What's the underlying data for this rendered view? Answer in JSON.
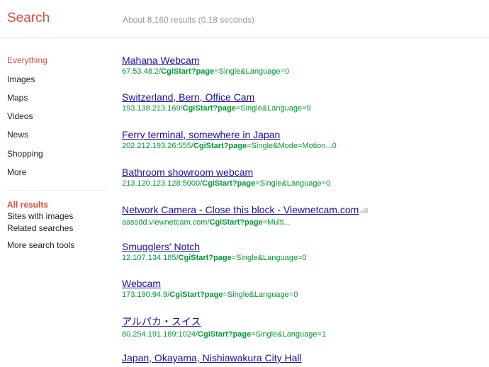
{
  "header": {
    "search_label": "Search",
    "result_stats": "About 8,160 results (0.18 seconds)"
  },
  "sidebar": {
    "categories": [
      "Everything",
      "Images",
      "Maps",
      "Videos",
      "News",
      "Shopping",
      "More"
    ],
    "active_category": "Everything",
    "filters": [
      "All results",
      "Sites with images",
      "Related searches"
    ],
    "active_filter": "All results",
    "more_tools": "More search tools"
  },
  "results": [
    {
      "title": "Mahana Webcam",
      "url_pre": "67.53.48.2/",
      "url_bold": "CgiStart?page",
      "url_post": "=Single&Language=0"
    },
    {
      "title": "Switzerland, Bern, Office Cam",
      "url_pre": "193.138.213.169/",
      "url_bold": "CgiStart?page",
      "url_post": "=Single&Language=9"
    },
    {
      "title": "Ferry terminal, somewhere in Japan",
      "url_pre": "202.212.193.26:555/",
      "url_bold": "CgiStart?page",
      "url_post": "=Single&Mode=Motion...0"
    },
    {
      "title": "Bathroom showroom webcam",
      "url_pre": "213.120.123.128:5000/",
      "url_bold": "CgiStart?page",
      "url_post": "=Single&Language=0"
    },
    {
      "title": "Network Camera - Close this block - Viewnetcam.com",
      "url_pre": "aassdd.viewnetcam.com/",
      "url_bold": "CgiStart?page",
      "url_post": "=Multi..."
    },
    {
      "title": "Smugglers' Notch",
      "url_pre": "12.107.134.185/",
      "url_bold": "CgiStart?page",
      "url_post": "=Single&Language=0"
    },
    {
      "title": "Webcam",
      "url_pre": "173.190.94.9/",
      "url_bold": "CgiStart?page",
      "url_post": "=Single&Language=0"
    },
    {
      "title": "アルパカ・スイス",
      "url_pre": "80.254.191.189:1024/",
      "url_bold": "CgiStart?page",
      "url_post": "=Single&Language=1"
    },
    {
      "title": "Japan, Okayama, Nishiawakura City Hall",
      "url_pre": "",
      "url_bold": "",
      "url_post": ""
    }
  ],
  "icons": {
    "signal": "signal-bars-icon"
  },
  "colors": {
    "accent": "#dd4b39",
    "link": "#1a0dab",
    "url": "#009933",
    "stats": "#999999"
  }
}
